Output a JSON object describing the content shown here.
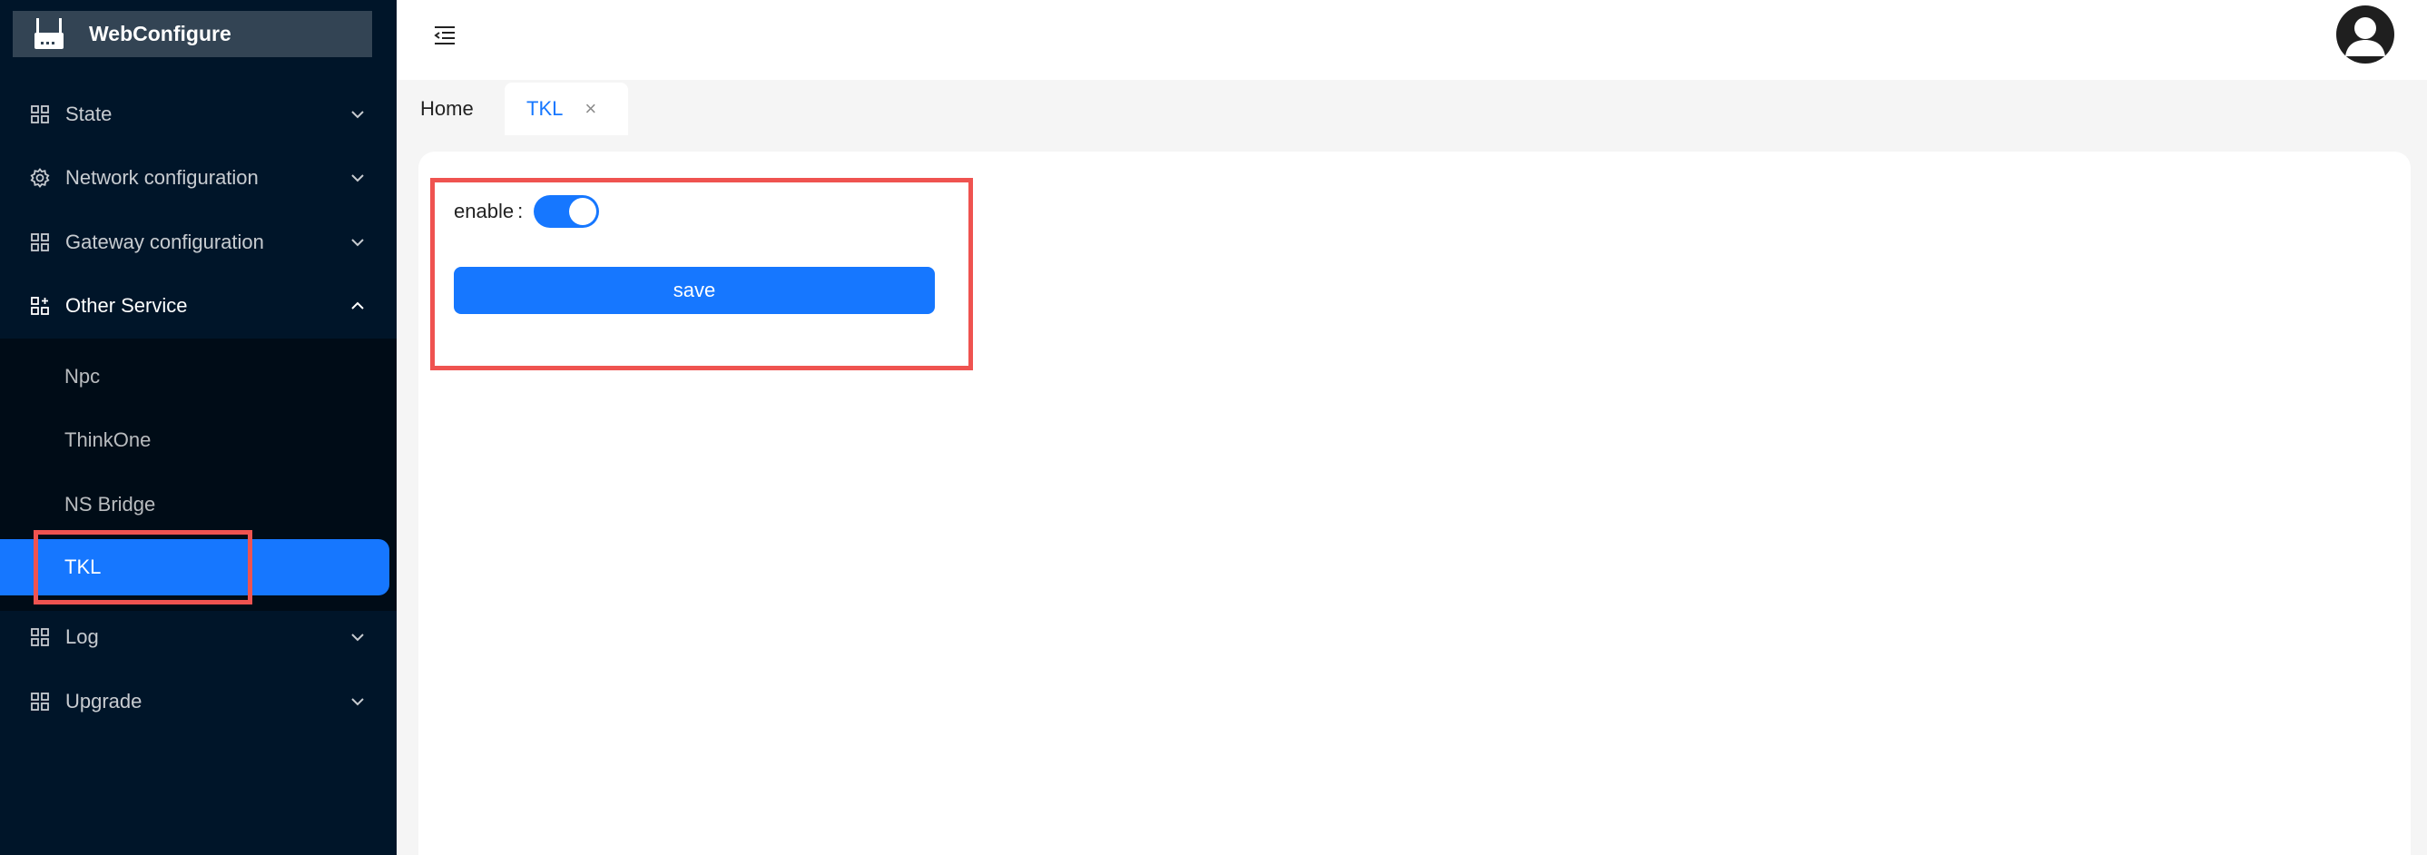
{
  "app": {
    "title": "WebConfigure"
  },
  "sidebar": {
    "items": [
      {
        "label": "State",
        "icon": "appstore-icon"
      },
      {
        "label": "Network configuration",
        "icon": "gear-icon"
      },
      {
        "label": "Gateway configuration",
        "icon": "appstore-icon"
      },
      {
        "label": "Other Service",
        "icon": "appstore-add-icon",
        "expanded": true,
        "children": [
          {
            "label": "Npc"
          },
          {
            "label": "ThinkOne"
          },
          {
            "label": "NS Bridge"
          },
          {
            "label": "TKL",
            "active": true
          }
        ]
      },
      {
        "label": "Log",
        "icon": "appstore-icon"
      },
      {
        "label": "Upgrade",
        "icon": "appstore-icon"
      }
    ]
  },
  "tabs": [
    {
      "label": "Home"
    },
    {
      "label": "TKL",
      "active": true,
      "closable": true,
      "close_glyph": "×"
    }
  ],
  "form": {
    "enable_label": "enable",
    "enable_colon": ":",
    "enable_value": true,
    "save_label": "save"
  },
  "colors": {
    "sidebar_bg": "#001529",
    "submenu_bg": "#000c17",
    "accent": "#1677ff",
    "annotation": "#ef5350"
  }
}
